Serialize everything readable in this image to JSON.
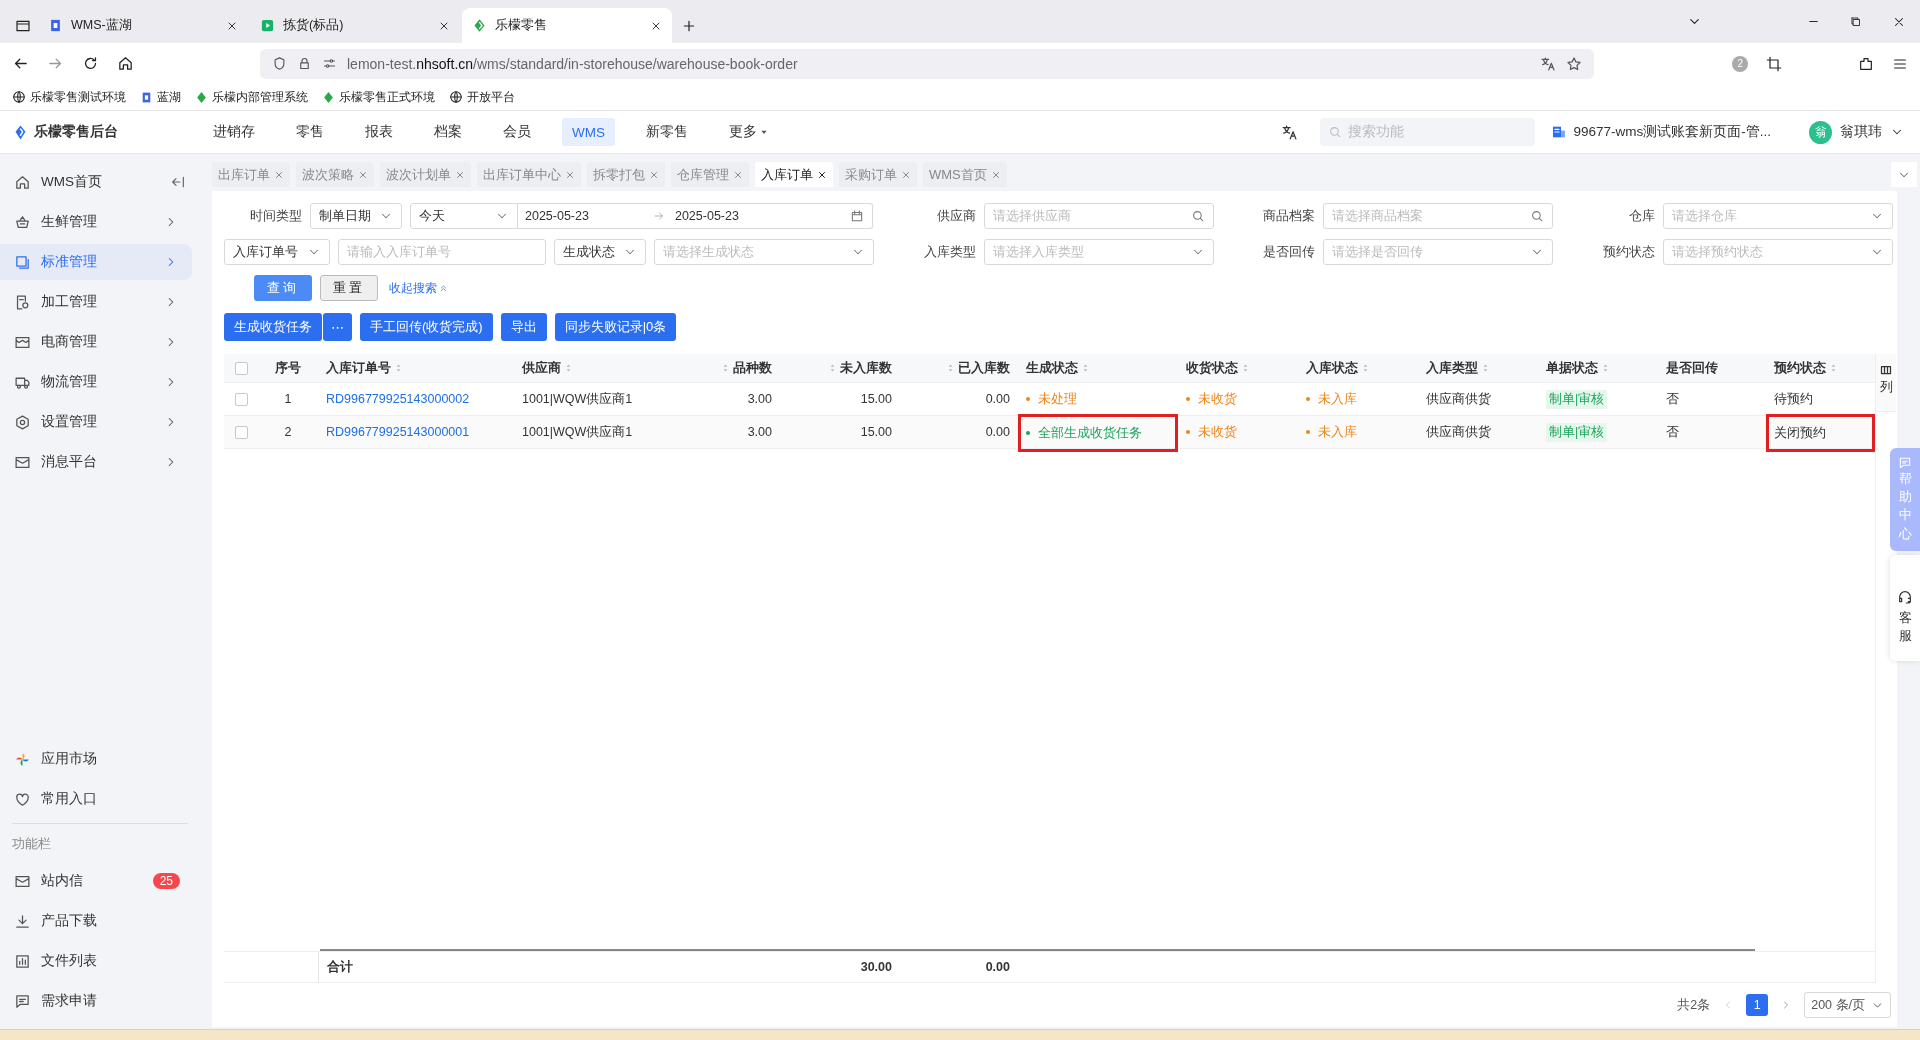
{
  "browser": {
    "tabs": [
      {
        "title": "WMS-蓝湖",
        "selected": false
      },
      {
        "title": "拣货(标品)",
        "selected": false
      },
      {
        "title": "乐檬零售",
        "selected": true
      }
    ],
    "url": "lemon-test.**nhsoft.cn**/wms/standard/in-storehouse/warehouse-book-order",
    "extension_badge": "2",
    "bookmarks": [
      "乐檬零售测试环境",
      "蓝湖",
      "乐檬内部管理系统",
      "乐檬零售正式环境",
      "开放平台"
    ]
  },
  "header": {
    "logo": "乐檬零售后台",
    "nav": [
      {
        "label": "进销存",
        "selected": false
      },
      {
        "label": "零售",
        "selected": false
      },
      {
        "label": "报表",
        "selected": false
      },
      {
        "label": "档案",
        "selected": false
      },
      {
        "label": "会员",
        "selected": false
      },
      {
        "label": "WMS",
        "selected": true
      },
      {
        "label": "新零售",
        "selected": false
      },
      {
        "label": "更多",
        "selected": false,
        "kind": "dropdown"
      }
    ],
    "search": {
      "placeholder": "搜索功能"
    },
    "account": "99677-wms测试账套新页面-管...",
    "user": {
      "avatar": "翁",
      "name": "翁琪玮"
    }
  },
  "sidebar": {
    "items": [
      {
        "label": "WMS首页",
        "kind": "link",
        "selected": false
      },
      {
        "label": "生鲜管理",
        "kind": "group",
        "selected": false
      },
      {
        "label": "标准管理",
        "kind": "group",
        "selected": true
      },
      {
        "label": "加工管理",
        "kind": "group",
        "selected": false
      },
      {
        "label": "电商管理",
        "kind": "group",
        "selected": false
      },
      {
        "label": "物流管理",
        "kind": "group",
        "selected": false
      },
      {
        "label": "设置管理",
        "kind": "group",
        "selected": false
      },
      {
        "label": "消息平台",
        "kind": "group",
        "selected": false
      }
    ],
    "shortcuts": [
      "应用市场",
      "常用入口"
    ],
    "section_title": "功能栏",
    "tools": [
      {
        "label": "站内信",
        "badge": "25"
      },
      {
        "label": "产品下载"
      },
      {
        "label": "文件列表"
      },
      {
        "label": "需求申请"
      }
    ]
  },
  "page_tabs": [
    {
      "label": "出库订单",
      "selected": false
    },
    {
      "label": "波次策略",
      "selected": false
    },
    {
      "label": "波次计划单",
      "selected": false
    },
    {
      "label": "出库订单中心",
      "selected": false
    },
    {
      "label": "拆零打包",
      "selected": false
    },
    {
      "label": "仓库管理",
      "selected": false
    },
    {
      "label": "入库订单",
      "selected": true
    },
    {
      "label": "采购订单",
      "selected": false
    },
    {
      "label": "WMS首页",
      "selected": false
    }
  ],
  "filters": {
    "rows": [
      [
        {
          "label": "时间类型",
          "controls": [
            {
              "kind": "select",
              "value": "制单日期"
            },
            {
              "kind": "select",
              "value": "今天"
            },
            {
              "kind": "date_range",
              "start": "2025-05-23",
              "end": "2025-05-23"
            }
          ]
        },
        {
          "label": "供应商",
          "controls": [
            {
              "kind": "search",
              "placeholder": "请选择供应商"
            }
          ]
        },
        {
          "label": "商品档案",
          "controls": [
            {
              "kind": "search",
              "placeholder": "请选择商品档案"
            }
          ]
        },
        {
          "label": "仓库",
          "controls": [
            {
              "kind": "select",
              "placeholder": "请选择仓库"
            }
          ]
        }
      ],
      [
        {
          "controls": [
            {
              "kind": "select",
              "value": "入库订单号"
            },
            {
              "kind": "input",
              "placeholder": "请输入入库订单号"
            },
            {
              "kind": "select",
              "value": "生成状态"
            },
            {
              "kind": "select",
              "placeholder": "请选择生成状态"
            }
          ]
        },
        {
          "label": "入库类型",
          "controls": [
            {
              "kind": "select",
              "placeholder": "请选择入库类型"
            }
          ]
        },
        {
          "label": "是否回传",
          "controls": [
            {
              "kind": "select",
              "placeholder": "请选择是否回传"
            }
          ]
        },
        {
          "label": "预约状态",
          "controls": [
            {
              "kind": "select",
              "placeholder": "请选择预约状态"
            }
          ]
        }
      ]
    ],
    "actions": [
      {
        "label": "查询",
        "kind": "primary"
      },
      {
        "label": "重置",
        "kind": "default"
      },
      {
        "label": "收起搜索",
        "kind": "link"
      }
    ]
  },
  "toolbar": [
    {
      "label": "生成收货任务",
      "kind": "split",
      "more": "⋯"
    },
    {
      "label": "手工回传(收货完成)",
      "kind": "primary"
    },
    {
      "label": "导出",
      "kind": "primary"
    },
    {
      "label": "同步失败记录|0条",
      "kind": "primary"
    }
  ],
  "table": {
    "select_all": {
      "checked": false
    },
    "columns": [
      {
        "label": "序号",
        "kind": "index",
        "sortable": false
      },
      {
        "label": "入库订单号",
        "kind": "text",
        "sortable": true
      },
      {
        "label": "供应商",
        "kind": "text",
        "sortable": true
      },
      {
        "label": "品种数",
        "kind": "number",
        "sortable": true
      },
      {
        "label": "未入库数",
        "kind": "number",
        "sortable": true
      },
      {
        "label": "已入库数",
        "kind": "number",
        "sortable": true
      },
      {
        "label": "生成状态",
        "kind": "text",
        "sortable": true
      },
      {
        "label": "收货状态",
        "kind": "text",
        "sortable": true
      },
      {
        "label": "入库状态",
        "kind": "text",
        "sortable": true
      },
      {
        "label": "入库类型",
        "kind": "text",
        "sortable": true
      },
      {
        "label": "单据状态",
        "kind": "text",
        "sortable": true
      },
      {
        "label": "是否回传",
        "kind": "text",
        "sortable": false
      },
      {
        "label": "预约状态",
        "kind": "text",
        "sortable": true
      }
    ],
    "rows": [
      {
        "checked": false,
        "cells": [
          {
            "text": "1",
            "kind": "index"
          },
          {
            "text": "RD996779925143000002",
            "kind": "link"
          },
          {
            "text": "1001|WQW供应商1",
            "kind": "text"
          },
          {
            "text": "3.00",
            "kind": "number"
          },
          {
            "text": "15.00",
            "kind": "number"
          },
          {
            "text": "0.00",
            "kind": "number"
          },
          {
            "text": "未处理",
            "kind": "status",
            "color": "#f08519"
          },
          {
            "text": "未收货",
            "kind": "status",
            "color": "#f08519"
          },
          {
            "text": "未入库",
            "kind": "status",
            "color": "#f08519"
          },
          {
            "text": "供应商供货",
            "kind": "text"
          },
          {
            "text": "制单|审核",
            "kind": "tag"
          },
          {
            "text": "否",
            "kind": "text"
          },
          {
            "text": "待预约",
            "kind": "text"
          }
        ]
      },
      {
        "checked": false,
        "cells": [
          {
            "text": "2",
            "kind": "index"
          },
          {
            "text": "RD996779925143000001",
            "kind": "link"
          },
          {
            "text": "1001|WQW供应商1",
            "kind": "text"
          },
          {
            "text": "3.00",
            "kind": "number"
          },
          {
            "text": "15.00",
            "kind": "number"
          },
          {
            "text": "0.00",
            "kind": "number"
          },
          {
            "text": "全部生成收货任务",
            "kind": "status",
            "color": "#1aa35a",
            "highlighted": true
          },
          {
            "text": "未收货",
            "kind": "status",
            "color": "#f08519"
          },
          {
            "text": "未入库",
            "kind": "status",
            "color": "#f08519"
          },
          {
            "text": "供应商供货",
            "kind": "text"
          },
          {
            "text": "制单|审核",
            "kind": "tag"
          },
          {
            "text": "否",
            "kind": "text"
          },
          {
            "text": "关闭预约",
            "kind": "text",
            "highlighted": true
          }
        ]
      }
    ],
    "summary": {
      "label": "合计",
      "values": [
        "30.00",
        "0.00"
      ]
    },
    "column_settings": "列"
  },
  "pagination": {
    "total": "共2条",
    "pages": [
      {
        "label": "1",
        "selected": true
      }
    ],
    "page_size": "200 条/页"
  },
  "float_tools": {
    "help": "帮助中心",
    "service": "客服"
  }
}
